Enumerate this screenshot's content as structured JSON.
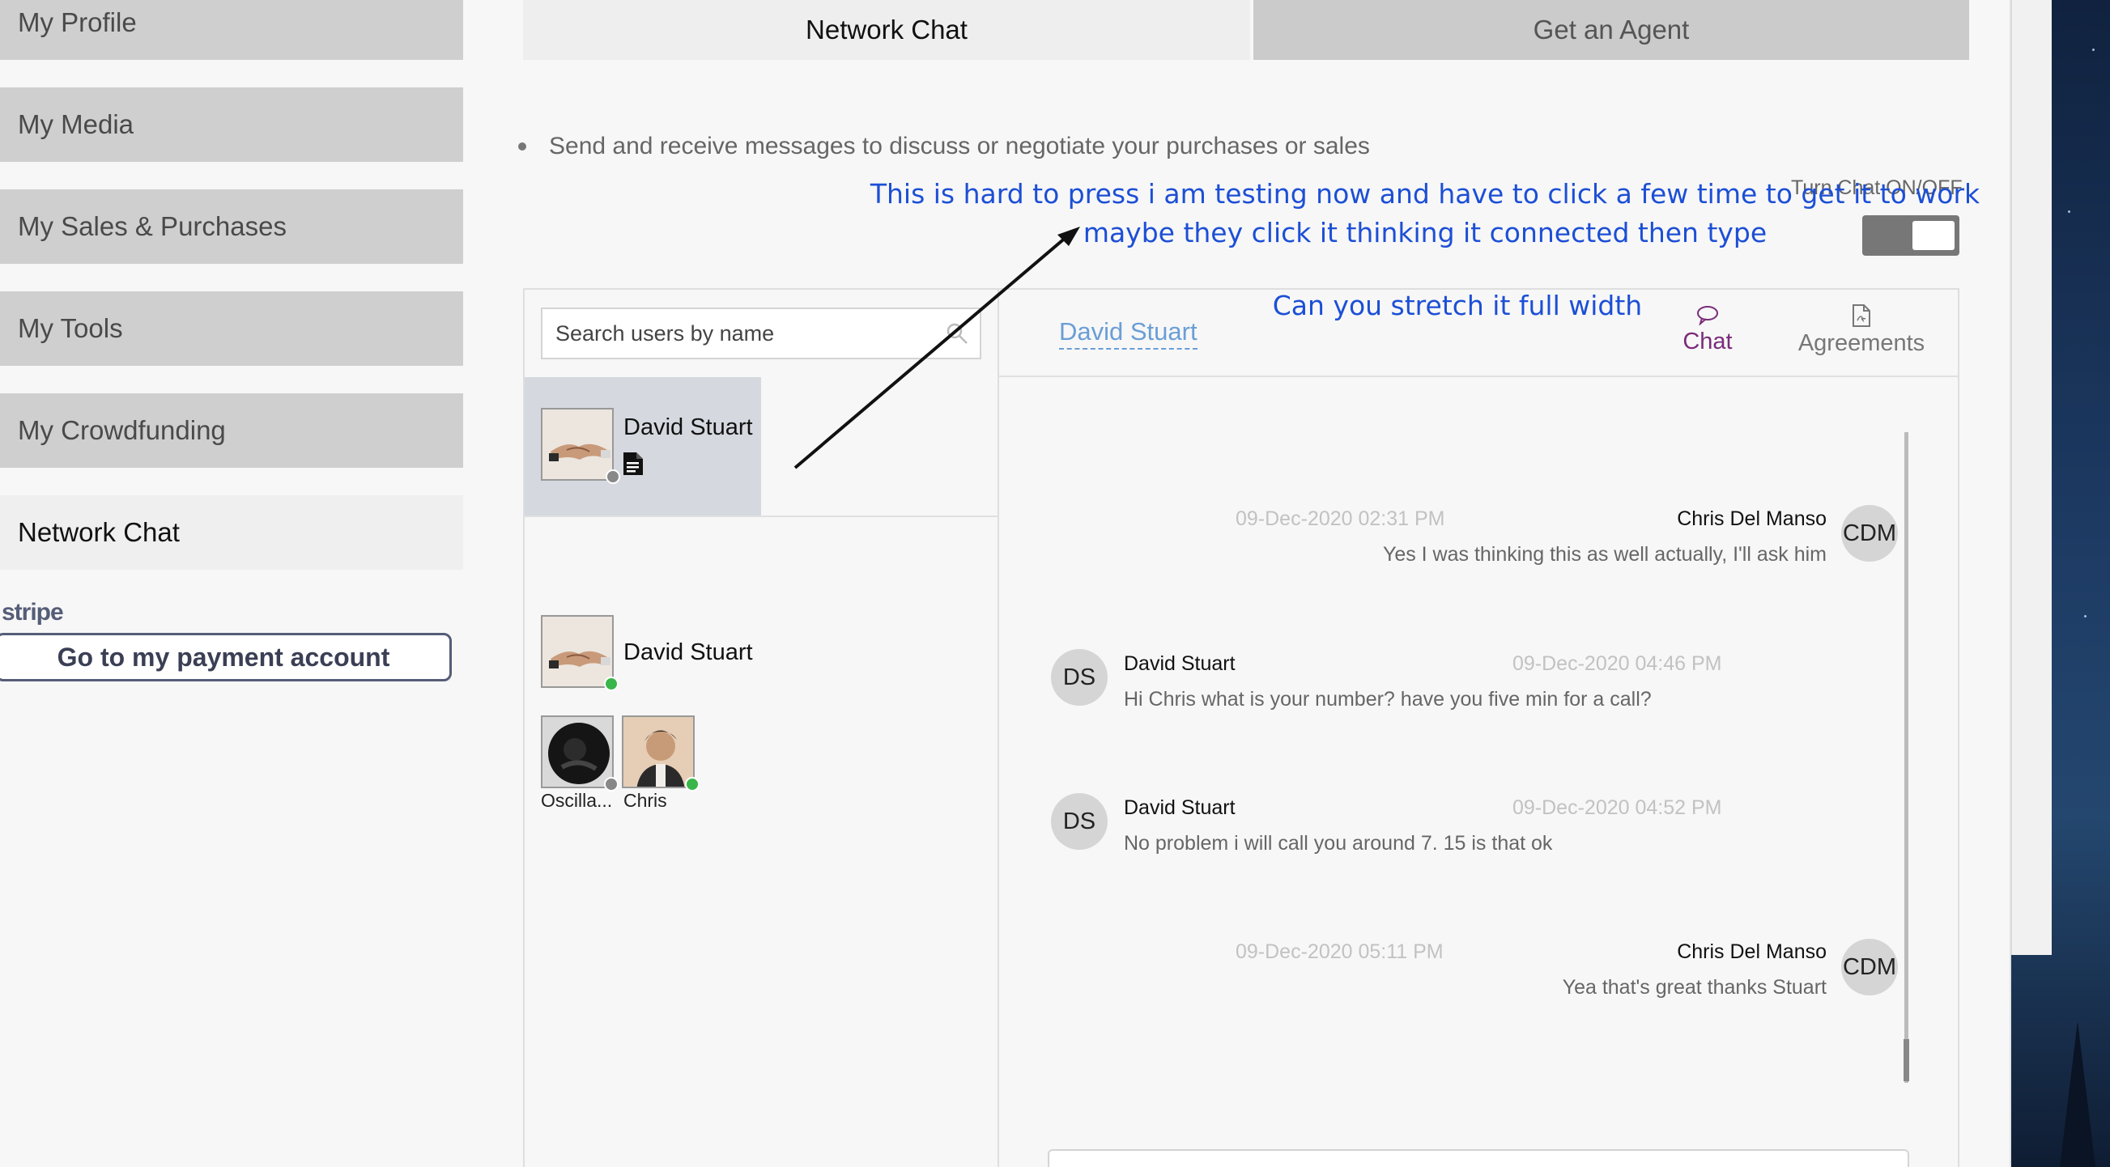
{
  "sidebar": {
    "items": [
      {
        "label": "My Profile"
      },
      {
        "label": "My Media"
      },
      {
        "label": "My Sales & Purchases"
      },
      {
        "label": "My Tools"
      },
      {
        "label": "My Crowdfunding"
      },
      {
        "label": "Network Chat"
      }
    ],
    "stripe_logo": "stripe",
    "payment_button": "Go to my payment account"
  },
  "tabs": [
    {
      "label": "Network Chat"
    },
    {
      "label": "Get an Agent"
    }
  ],
  "intro_bullet": "Send and receive messages to discuss or negotiate your purchases or sales",
  "toggle": {
    "label": "Turn Chat ON/OFF",
    "state": "on"
  },
  "annotations": {
    "note1": "This is hard to press i am testing now and have to click a few time to get it to work maybe they click it thinking it connected then type",
    "note2": "Can you stretch it full width"
  },
  "search": {
    "placeholder": "Search users by name"
  },
  "conversations": [
    {
      "name": "David Stuart",
      "status": "offline",
      "has_document": true
    }
  ],
  "contacts_group": {
    "name": "David Stuart",
    "status": "online",
    "members": [
      {
        "name": "Oscilla...",
        "status": "offline"
      },
      {
        "name": "Chris",
        "status": "online"
      }
    ]
  },
  "chat": {
    "header_name": "David Stuart",
    "tabs": [
      {
        "label": "Chat",
        "icon": "speech-bubble-icon"
      },
      {
        "label": "Agreements",
        "icon": "pdf-document-icon"
      }
    ],
    "messages": [
      {
        "sender": "Chris Del Manso",
        "initials": "CDM",
        "time": "09-Dec-2020 02:31 PM",
        "text": "Yes I was thinking this as well actually, I'll ask him",
        "side": "right"
      },
      {
        "sender": "David Stuart",
        "initials": "DS",
        "time": "09-Dec-2020 04:46 PM",
        "text": "Hi Chris what is your number? have you five min for a call?",
        "side": "left"
      },
      {
        "sender": "David Stuart",
        "initials": "DS",
        "time": "09-Dec-2020 04:52 PM",
        "text": "No problem i will call you around 7. 15 is that ok",
        "side": "left"
      },
      {
        "sender": "Chris Del Manso",
        "initials": "CDM",
        "time": "09-Dec-2020 05:11 PM",
        "text": "Yea that's great thanks Stuart",
        "side": "right"
      }
    ]
  },
  "colors": {
    "annotation": "#1c4fd6",
    "chat_tab_active": "#7a2c7a",
    "header_link": "#6a9ed6",
    "online": "#3ab54a",
    "offline": "#888888"
  }
}
